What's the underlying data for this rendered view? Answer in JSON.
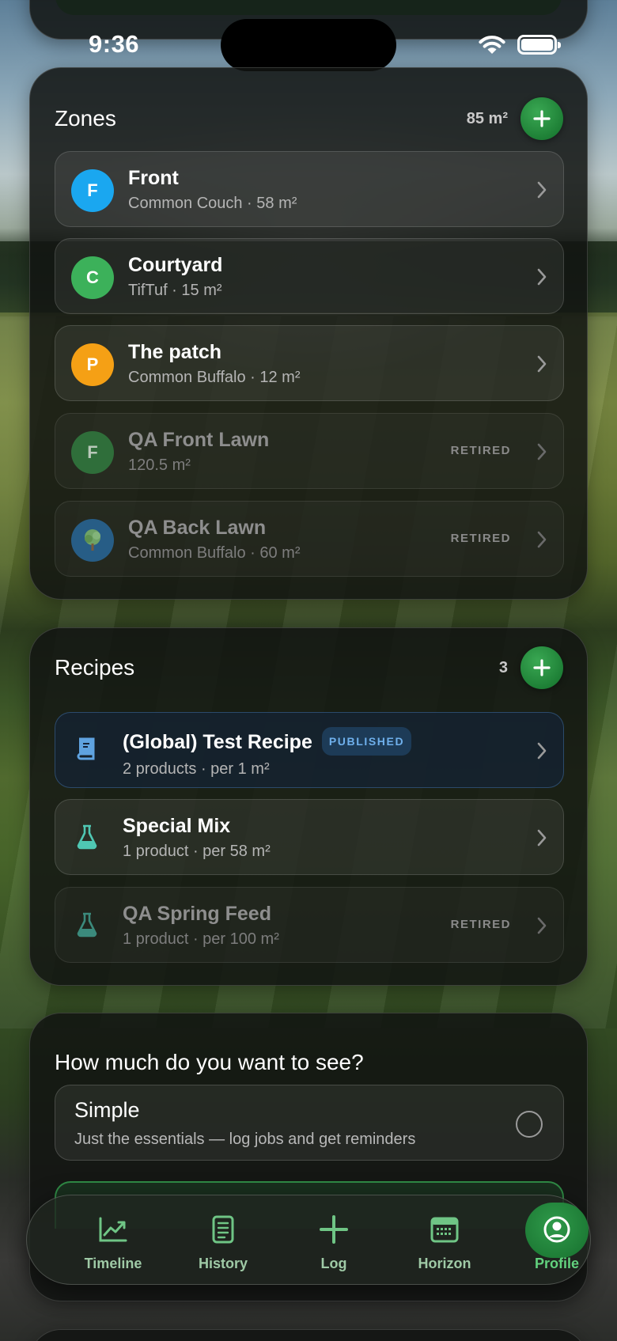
{
  "status_bar": {
    "time": "9:36"
  },
  "zones": {
    "title": "Zones",
    "total_area": "85 m²",
    "items": [
      {
        "initial": "F",
        "name": "Front",
        "detail": "Common Couch · 58 m²",
        "color": "#1aa7f0",
        "retired_label": ""
      },
      {
        "initial": "C",
        "name": "Courtyard",
        "detail": "TifTuf · 15 m²",
        "color": "#3cb15a",
        "retired_label": ""
      },
      {
        "initial": "P",
        "name": "The patch",
        "detail": "Common Buffalo · 12 m²",
        "color": "#f5a015",
        "retired_label": ""
      },
      {
        "initial": "F",
        "name": "QA Front Lawn",
        "detail": "120.5 m²",
        "color": "#2f6e3a",
        "retired_label": "RETIRED"
      },
      {
        "initial": "tree-icon",
        "name": "QA Back Lawn",
        "detail": "Common Buffalo · 60 m²",
        "color": "#275d86",
        "retired_label": "RETIRED"
      }
    ]
  },
  "recipes": {
    "title": "Recipes",
    "count": "3",
    "items": [
      {
        "icon": "book-icon",
        "name": "(Global) Test Recipe",
        "badge": "PUBLISHED",
        "detail": "2 products · per 1 m²",
        "retired_label": ""
      },
      {
        "icon": "flask-icon",
        "name": "Special Mix",
        "badge": "",
        "detail": "1 product · per 58 m²",
        "retired_label": ""
      },
      {
        "icon": "flask-icon",
        "name": "QA Spring Feed",
        "badge": "",
        "detail": "1 product · per 100 m²",
        "retired_label": "RETIRED"
      }
    ]
  },
  "view_mode": {
    "question": "How much do you want to see?",
    "options": [
      {
        "title": "Simple",
        "description": "Just the essentials — log jobs and get reminders"
      }
    ]
  },
  "tabbar": {
    "tabs": [
      {
        "label": "Timeline",
        "icon": "trend-chart-icon"
      },
      {
        "label": "History",
        "icon": "document-list-icon"
      },
      {
        "label": "Log",
        "icon": "plus-icon"
      },
      {
        "label": "Horizon",
        "icon": "calendar-icon"
      },
      {
        "label": "Profile",
        "icon": "profile-circle-icon",
        "active": true
      }
    ]
  },
  "colors": {
    "accent_green": "#1d7a35",
    "tab_label": "#9fcaa6",
    "active_tab_label": "#62d27e",
    "published_badge": "#6fb0ec"
  }
}
